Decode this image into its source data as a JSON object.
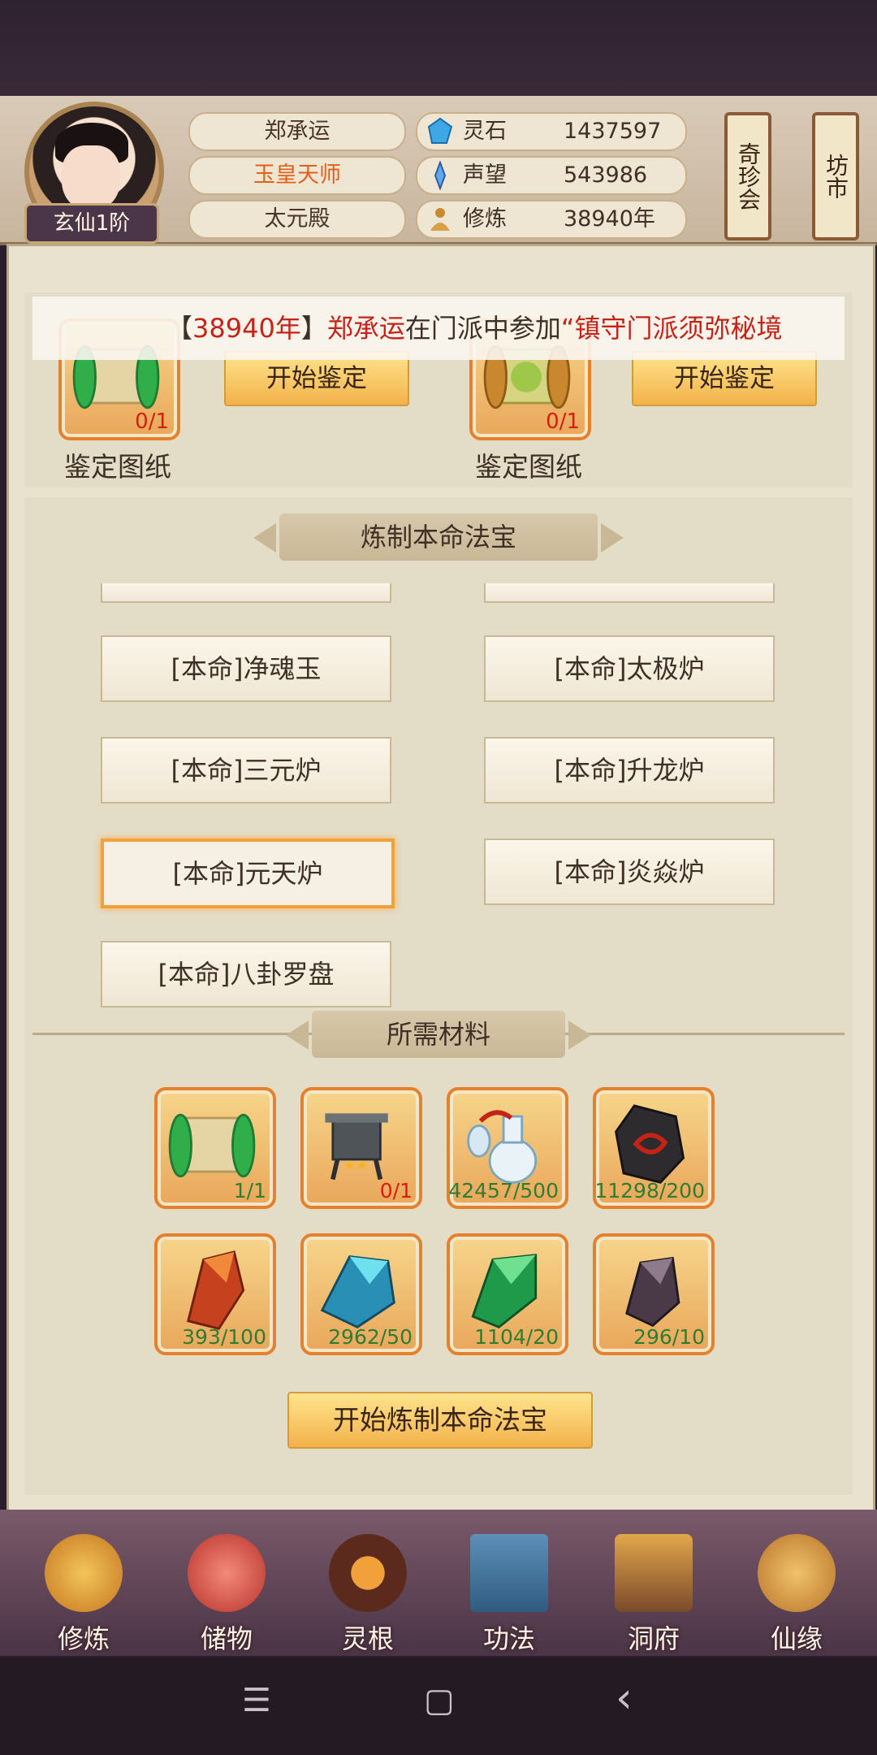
{
  "player": {
    "name": "郑承运",
    "title": "玉皇天师",
    "sect": "太元殿",
    "realm": "玄仙1阶"
  },
  "resources": [
    {
      "label": "灵石",
      "value": "1437597",
      "icon": "spirit-stone-icon"
    },
    {
      "label": "声望",
      "value": "543986",
      "icon": "reputation-icon"
    },
    {
      "label": "修炼",
      "value": "38940年",
      "icon": "cultivation-icon"
    }
  ],
  "side_buttons": [
    "奇珍会",
    "坊市"
  ],
  "ticker": {
    "bracket_open": "【",
    "year": "38940年",
    "bracket_close": "】",
    "name": "郑承运",
    "middle": "在门派中参加",
    "quote": "“镇守门派须弥秘境"
  },
  "identify": [
    {
      "count": "0/1",
      "button": "开始鉴定",
      "label": "鉴定图纸"
    },
    {
      "count": "0/1",
      "button": "开始鉴定",
      "label": "鉴定图纸"
    }
  ],
  "forge_title": "炼制本命法宝",
  "items": [
    "[本命]净魂玉",
    "[本命]太极炉",
    "[本命]三元炉",
    "[本命]升龙炉",
    "[本命]元天炉",
    "[本命]炎焱炉",
    "[本命]八卦罗盘"
  ],
  "materials_title": "所需材料",
  "materials": [
    {
      "count": "1/1",
      "icon": "scroll-icon",
      "status": "ok"
    },
    {
      "count": "0/1",
      "icon": "cauldron-icon",
      "status": "lack"
    },
    {
      "count": "42457/500",
      "icon": "vase-icon",
      "status": "ok"
    },
    {
      "count": "11298/200",
      "icon": "dark-stone-icon",
      "status": "ok"
    },
    {
      "count": "393/100",
      "icon": "red-crystal-icon",
      "status": "ok"
    },
    {
      "count": "2962/50",
      "icon": "blue-crystal-icon",
      "status": "ok"
    },
    {
      "count": "1104/20",
      "icon": "green-crystal-icon",
      "status": "ok"
    },
    {
      "count": "296/10",
      "icon": "purple-crystal-icon",
      "status": "ok"
    }
  ],
  "forge_button": "开始炼制本命法宝",
  "nav": [
    "修炼",
    "储物",
    "灵根",
    "功法",
    "洞府",
    "仙缘"
  ],
  "system_nav": {
    "menu": "☰",
    "home": "▢",
    "back": "‹"
  },
  "colors": {
    "accent": "#f2a13a",
    "warn": "#d61e10",
    "ok": "#2e7d32"
  }
}
